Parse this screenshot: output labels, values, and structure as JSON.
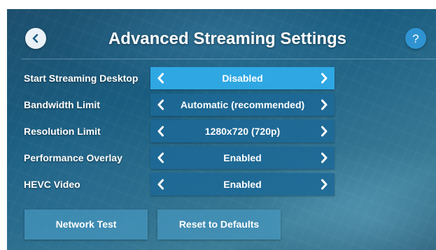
{
  "header": {
    "title": "Advanced Streaming Settings",
    "back_icon": "chevron-left-icon",
    "help_label": "?"
  },
  "settings": [
    {
      "label": "Start Streaming Desktop",
      "value": "Disabled"
    },
    {
      "label": "Bandwidth Limit",
      "value": "Automatic (recommended)"
    },
    {
      "label": "Resolution Limit",
      "value": "1280x720 (720p)"
    },
    {
      "label": "Performance Overlay",
      "value": "Enabled"
    },
    {
      "label": "HEVC Video",
      "value": "Enabled"
    }
  ],
  "buttons": {
    "network_test": "Network Test",
    "reset_defaults": "Reset to Defaults"
  },
  "colors": {
    "accent": "#2ea7e3",
    "selector": "#1c6996",
    "help": "#2f93d1"
  }
}
